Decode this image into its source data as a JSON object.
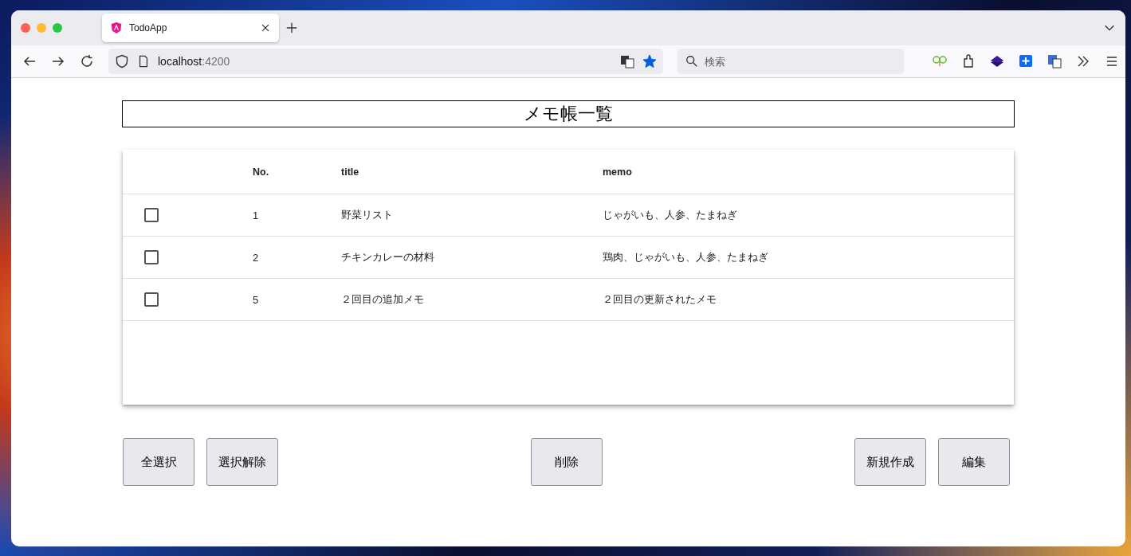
{
  "browser": {
    "tab": {
      "title": "TodoApp",
      "selected": true
    },
    "url": {
      "host": "localhost",
      "port": ":4200"
    },
    "search": {
      "placeholder": "検索"
    },
    "bookmarked": true
  },
  "page": {
    "title": "メモ帳一覧",
    "table": {
      "columns": [
        "No.",
        "title",
        "memo"
      ],
      "rows": [
        {
          "checked": false,
          "no": "1",
          "title": "野菜リスト",
          "memo": "じゃがいも、人参、たまねぎ"
        },
        {
          "checked": false,
          "no": "2",
          "title": "チキンカレーの材料",
          "memo": "鶏肉、じゃがいも、人参、たまねぎ"
        },
        {
          "checked": false,
          "no": "5",
          "title": "２回目の追加メモ",
          "memo": "２回目の更新されたメモ"
        }
      ]
    },
    "buttons": {
      "left": [
        "全選択",
        "選択解除"
      ],
      "center": [
        "削除"
      ],
      "right": [
        "新規作成",
        "編集"
      ]
    }
  }
}
